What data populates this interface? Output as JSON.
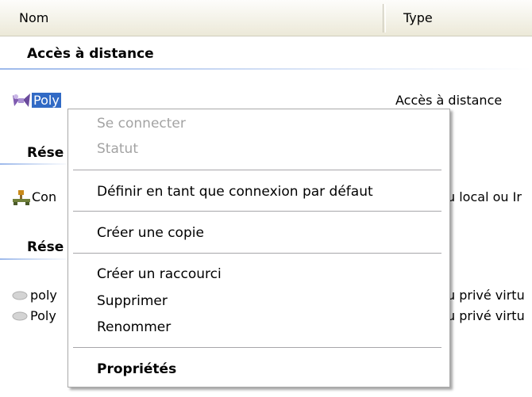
{
  "columns": {
    "name": "Nom",
    "type": "Type"
  },
  "groups": {
    "remote": {
      "title": "Accès à distance"
    },
    "lan": {
      "title": "Rése"
    },
    "vpn": {
      "title": "Rése"
    }
  },
  "rows": {
    "poly_remote": {
      "name": "Poly",
      "type": "Accès à distance"
    },
    "lan_conn": {
      "name": "Con",
      "type": "u local ou Ir"
    },
    "vpn1": {
      "name": "poly",
      "type": "u privé virtu"
    },
    "vpn2": {
      "name": "Poly",
      "type": "u privé virtu"
    }
  },
  "menu": {
    "connect": "Se connecter",
    "status": "Statut",
    "set_default": "Définir en tant que connexion par défaut",
    "copy": "Créer une copie",
    "shortcut": "Créer un raccourci",
    "delete": "Supprimer",
    "rename": "Renommer",
    "properties": "Propriétés"
  },
  "colors": {
    "selection": "#316ac5",
    "disabled": "#a3a3a3"
  },
  "icons": {
    "remote": "dialup-connection-icon",
    "lan": "lan-connection-icon",
    "vpn": "vpn-connection-icon"
  }
}
